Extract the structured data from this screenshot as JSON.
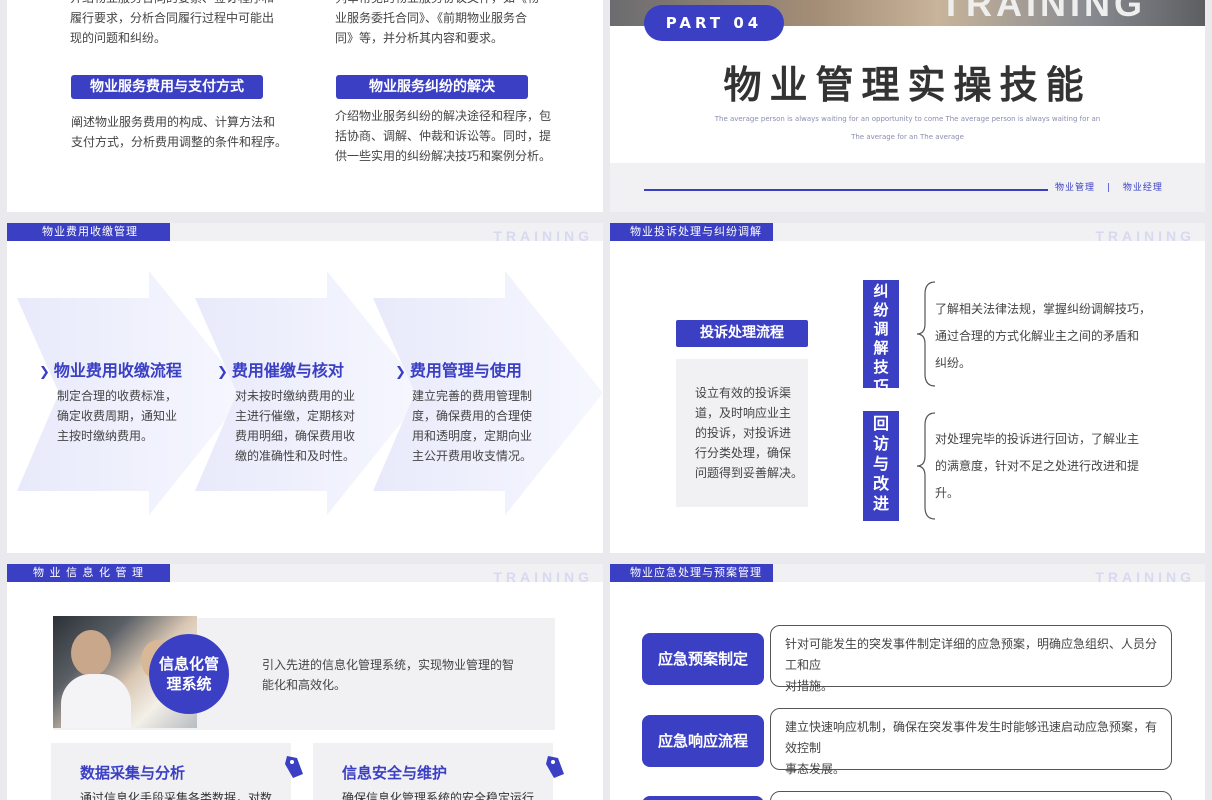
{
  "slide1": {
    "col1_top_text": "介绍物业服务合同的要素、签订程序和履行要求，分析合同履行过程中可能出现的问题和纠纷。",
    "col1_top_lines": [
      "介绍物业服务合同的要素、签订程序和",
      "履行要求，分析合同履行过程中可能出",
      "现的问题和纠纷。"
    ],
    "col2_top_lines": [
      "列举常见的物业服务协议文件，如《物",
      "业服务委托合同》、《前期物业服务合",
      "同》等，并分析其内容和要求。"
    ],
    "col1_title": "物业服务费用与支付方式",
    "col1_lines": [
      "阐述物业服务费用的构成、计算方法和",
      "支付方式，分析费用调整的条件和程序。"
    ],
    "col2_title": "物业服务纠纷的解决",
    "col2_lines": [
      "介绍物业服务纠纷的解决途径和程序，包",
      "括协商、调解、仲裁和诉讼等。同时，提",
      "供一些实用的纠纷解决技巧和案例分析。"
    ]
  },
  "slide2": {
    "part": "PART 04",
    "bg_word": "TRAINING",
    "title": "物业管理实操技能",
    "sub1": "The average person is always waiting for an opportunity to come The average person is always waiting for an",
    "sub2": "The average for an The average",
    "tag1": "物业管理",
    "sep": "|",
    "tag2": "物业经理"
  },
  "slide3": {
    "header": "物业费用收缴管理",
    "train": "TRAINING",
    "items": [
      {
        "title": "物业费用收缴流程",
        "lines": [
          "制定合理的收费标准，",
          "确定收费周期，通知业",
          "主按时缴纳费用。"
        ]
      },
      {
        "title": "费用催缴与核对",
        "lines": [
          "对未按时缴纳费用的业",
          "主进行催缴，定期核对",
          "费用明细，确保费用收",
          "缴的准确性和及时性。"
        ]
      },
      {
        "title": "费用管理与使用",
        "lines": [
          "建立完善的费用管理制",
          "度，确保费用的合理使",
          "用和透明度，定期向业",
          "主公开费用收支情况。"
        ]
      }
    ]
  },
  "slide4": {
    "header": "物业投诉处理与纠纷调解",
    "train": "TRAINING",
    "flow_title": "投诉处理流程",
    "flow_lines": [
      "设立有效的投诉渠",
      "道，及时响应业主",
      "的投诉，对投诉进",
      "行分类处理，确保",
      "问题得到妥善解决。"
    ],
    "skill1_label": [
      "纠",
      "纷",
      "调",
      "解",
      "技",
      "巧"
    ],
    "skill1_lines": [
      "了解相关法律法规，掌握纠纷调解技巧，",
      "通过合理的方式化解业主之间的矛盾和",
      "纠纷。"
    ],
    "skill2_label": [
      "回",
      "访",
      "与",
      "改",
      "进"
    ],
    "skill2_lines": [
      "对处理完毕的投诉进行回访，了解业主",
      "的满意度，针对不足之处进行改进和提",
      "升。"
    ]
  },
  "slide5": {
    "header": "物 业 信 息 化 管 理",
    "train": "TRAINING",
    "circle_line1": "信息化管",
    "circle_line2": "理系统",
    "intro_lines": [
      "引入先进的信息化管理系统，实现物业管理的智",
      "能化和高效化。"
    ],
    "card1_title": "数据采集与分析",
    "card1_text": "通过信息化手段采集各类数据，对数",
    "card2_title": "信息安全与维护",
    "card2_text": "确保信息化管理系统的安全稳定运行"
  },
  "slide6": {
    "header": "物业应急处理与预案管理",
    "train": "TRAINING",
    "rows": [
      {
        "label": "应急预案制定",
        "lines": [
          "针对可能发生的突发事件制定详细的应急预案，明确应急组织、人员分工和应",
          "对措施。"
        ]
      },
      {
        "label": "应急响应流程",
        "lines": [
          "建立快速响应机制，确保在突发事件发生时能够迅速启动应急预案，有效控制",
          "事态发展。"
        ]
      }
    ]
  },
  "colors": {
    "accent": "#3b3fc4",
    "light": "#eceefb"
  }
}
